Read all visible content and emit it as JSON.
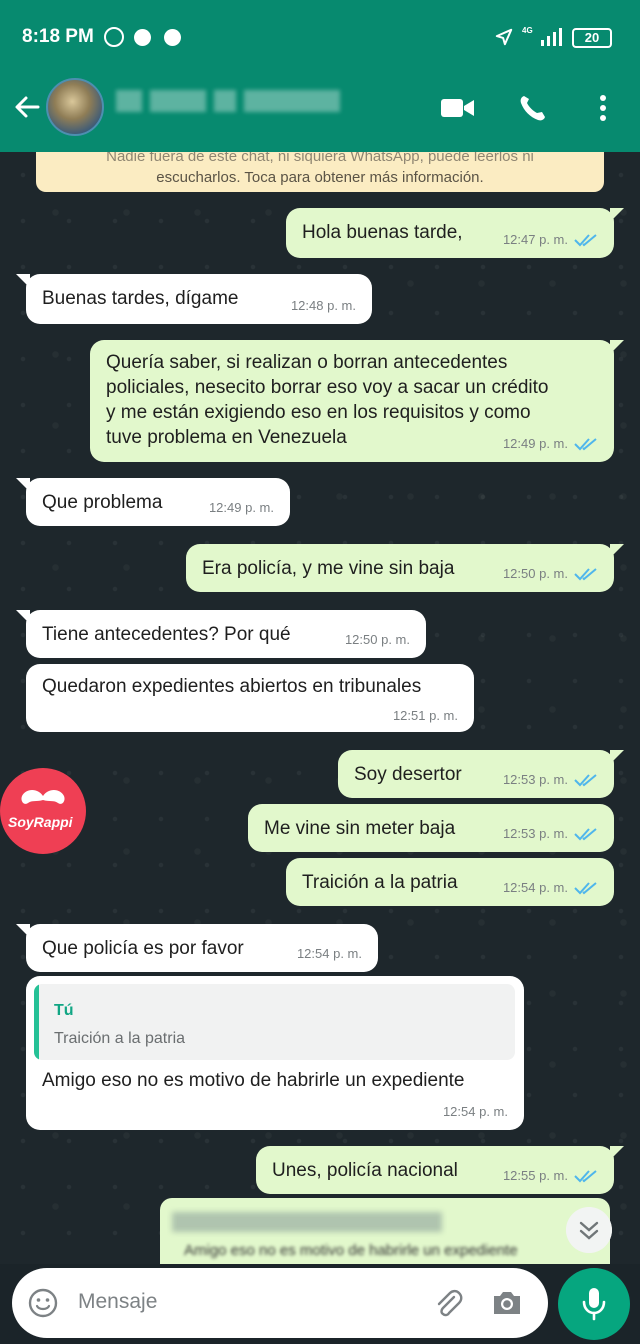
{
  "status_bar": {
    "time": "8:18 PM",
    "network": "4G",
    "battery": "20"
  },
  "header": {
    "back_label": "Back",
    "contact_name": ""
  },
  "encryption_notice": {
    "line1": "Nadie fuera de este chat, ni siquiera WhatsApp, puede leerlos ni",
    "line2": "escucharlos. Toca para obtener más información."
  },
  "messages": [
    {
      "dir": "out",
      "text": "Hola buenas tarde,",
      "time": "12:47 p. m."
    },
    {
      "dir": "in",
      "text": "Buenas tardes, dígame",
      "time": "12:48 p. m."
    },
    {
      "dir": "out",
      "lines": [
        "Quería saber, si realizan o borran antecedentes",
        "policiales, nesecito borrar eso voy a sacar un crédito",
        "y me están exigiendo eso en los requisitos y como",
        "tuve problema en Venezuela"
      ],
      "time": "12:49 p. m."
    },
    {
      "dir": "in",
      "text": "Que problema",
      "time": "12:49 p. m."
    },
    {
      "dir": "out",
      "text": "Era policía, y me vine sin baja",
      "time": "12:50 p. m."
    },
    {
      "dir": "in",
      "text": "Tiene antecedentes? Por qué",
      "time": "12:50 p. m."
    },
    {
      "dir": "in",
      "text": "Quedaron expedientes abiertos en tribunales",
      "time": "12:51 p. m."
    },
    {
      "dir": "out",
      "text": "Soy desertor",
      "time": "12:53 p. m."
    },
    {
      "dir": "out",
      "text": "Me vine sin meter baja",
      "time": "12:53 p. m."
    },
    {
      "dir": "out",
      "text": "Traición a la patria",
      "time": "12:54 p. m."
    },
    {
      "dir": "in",
      "text": "Que policía es por favor",
      "time": "12:54 p. m."
    },
    {
      "dir": "in",
      "quote_author": "Tú",
      "quote_text": "Traición a la patria",
      "text": "Amigo eso no es motivo de habrirle un expediente",
      "time": "12:54 p. m."
    },
    {
      "dir": "out",
      "text": "Unes, policía nacional",
      "time": "12:55 p. m."
    }
  ],
  "overlay_badge": {
    "text": "SoyRappi"
  },
  "draft_reply": {
    "quoted_text": "Amigo eso no es motivo de habrirle un expediente"
  },
  "input": {
    "placeholder": "Mensaje"
  },
  "colors": {
    "header": "#078a6f",
    "outgoing": "#e2f8cc",
    "incoming": "#ffffff",
    "tick_read": "#4fb6ec",
    "mic": "#06a67f"
  }
}
